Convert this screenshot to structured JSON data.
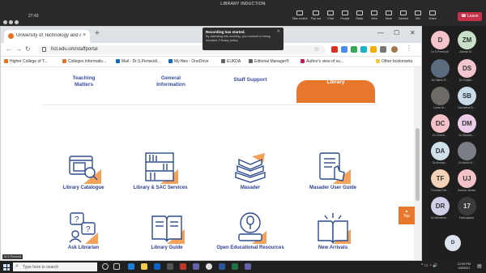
{
  "teams": {
    "meeting_title": "LIBRARY INDUCTION",
    "timer": "27:43",
    "toolbar": [
      {
        "name": "take-control",
        "label": "Take control"
      },
      {
        "name": "pop-out",
        "label": "Pop out"
      },
      {
        "name": "chat",
        "label": "Chat"
      },
      {
        "name": "people",
        "label": "People"
      },
      {
        "name": "raise",
        "label": "Raise"
      },
      {
        "name": "view",
        "label": "View"
      },
      {
        "name": "more",
        "label": "More"
      },
      {
        "name": "camera",
        "label": "Camera"
      },
      {
        "name": "mic",
        "label": "Mic"
      },
      {
        "name": "share",
        "label": "Share"
      }
    ],
    "leave_label": "Leave",
    "presenter_label": "Dr.S.Periwodi",
    "recording": {
      "title": "Recording has started.",
      "body": "By attending this meeting, you consent to being included. Privacy policy"
    },
    "participants": [
      {
        "initials": "D",
        "name": "Dr.S.Periwodi",
        "color": "#f4c4c9"
      },
      {
        "initials": "ZM",
        "name": "Zainab M...",
        "color": "#c9dfc7"
      },
      {
        "initials": "",
        "name": "Dr.Hakim R...",
        "color": "#5b6b7e",
        "photo": true
      },
      {
        "initials": "DS",
        "name": "Dr.Debjan...",
        "color": "#f3c6cd"
      },
      {
        "initials": "",
        "name": "Umar M...",
        "color": "#6e6a66",
        "photo": true
      },
      {
        "initials": "SB",
        "name": "Sameena B...",
        "color": "#c7dbe8"
      },
      {
        "initials": "DC",
        "name": "Dr.Chand...",
        "color": "#f5c1c9"
      },
      {
        "initials": "DM",
        "name": "Dr.Mariam...",
        "color": "#eccce9"
      },
      {
        "initials": "DA",
        "name": "Dr.Ahmad...",
        "color": "#cfe0ea"
      },
      {
        "initials": "",
        "name": "Dr.Abdul N...",
        "color": "#7a7f87",
        "photo": true
      },
      {
        "initials": "TF",
        "name": "Thomas Fen...",
        "color": "#f2d2b8"
      },
      {
        "initials": "UJ",
        "name": "Usama Jaman",
        "color": "#f3c2c9"
      },
      {
        "initials": "DR",
        "name": "Dr.Mohamm...",
        "color": "#cfcfe8"
      },
      {
        "initials": "17",
        "name": "Participants",
        "color": "#3a3a3a"
      },
      {
        "initials": "D",
        "name": "",
        "color": "#dbe4ef"
      }
    ]
  },
  "browser": {
    "tab_title": "University of Technology and Ap...",
    "url": "hct.edu.om/staffportal",
    "bookmarks": [
      "Higher College of T...",
      "Colleges Informatio...",
      "Mail - Dr.S.Periwodi...",
      "My files - OneDrive",
      "EUKDA",
      "Editorial Manager®",
      "Author's view of su...",
      "Other bookmarks"
    ]
  },
  "portal": {
    "tabs": [
      {
        "line1": "Teaching",
        "line2": "Matters",
        "active": false
      },
      {
        "line1": "General",
        "line2": "Information",
        "active": false
      },
      {
        "line1": "Staff Support",
        "line2": "",
        "active": false
      },
      {
        "line1": "Library",
        "line2": "",
        "active": true
      }
    ],
    "tiles": [
      {
        "label": "Library Catalogue",
        "icon": "catalogue-icon"
      },
      {
        "label": "Library & SAC Services",
        "icon": "bookshelf-icon"
      },
      {
        "label": "Masader",
        "icon": "open-books-icon"
      },
      {
        "label": "Masader User Guide",
        "icon": "guide-document-icon"
      },
      {
        "label": "Ask Librarian",
        "icon": "question-bubbles-icon"
      },
      {
        "label": "Library Guide",
        "icon": "open-book-icon"
      },
      {
        "label": "Open Educational Resources",
        "icon": "oer-icon"
      },
      {
        "label": "New Arrivals",
        "icon": "new-arrivals-icon"
      }
    ],
    "to_top_label": "Top"
  },
  "taskbar": {
    "search_placeholder": "Type here to search",
    "time": "12:06 PM",
    "date": "4/5/2021"
  }
}
